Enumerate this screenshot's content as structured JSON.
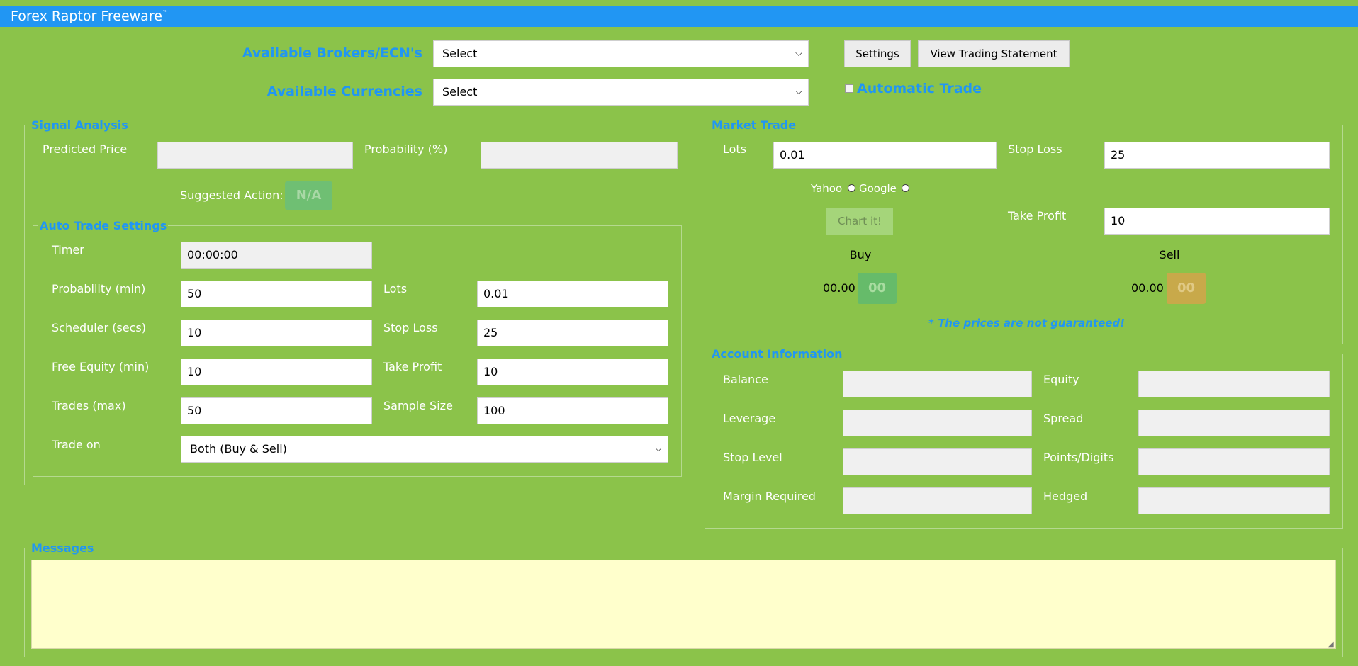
{
  "app": {
    "title": "Forex Raptor Freeware",
    "trademark": "™"
  },
  "header": {
    "brokers_label": "Available Brokers/ECN's",
    "brokers_value": "Select",
    "currencies_label": "Available Currencies",
    "currencies_value": "Select",
    "settings_button": "Settings",
    "statement_button": "View Trading Statement",
    "auto_trade_label": "Automatic Trade"
  },
  "signal_analysis": {
    "legend": "Signal Analysis",
    "predicted_price_label": "Predicted Price",
    "predicted_price_value": "",
    "probability_label": "Probability (%)",
    "probability_value": "",
    "suggested_action_label": "Suggested Action:",
    "suggested_action_value": "N/A"
  },
  "auto_trade": {
    "legend": "Auto Trade Settings",
    "timer_label": "Timer",
    "timer_value": "00:00:00",
    "prob_min_label": "Probability (min)",
    "prob_min_value": "50",
    "lots_label": "Lots",
    "lots_value": "0.01",
    "scheduler_label": "Scheduler (secs)",
    "scheduler_value": "10",
    "stop_loss_label": "Stop Loss",
    "stop_loss_value": "25",
    "free_equity_label": "Free Equity (min)",
    "free_equity_value": "10",
    "take_profit_label": "Take Profit",
    "take_profit_value": "10",
    "trades_max_label": "Trades (max)",
    "trades_max_value": "50",
    "sample_size_label": "Sample Size",
    "sample_size_value": "100",
    "trade_on_label": "Trade on",
    "trade_on_value": "Both (Buy & Sell)"
  },
  "market_trade": {
    "legend": "Market Trade",
    "lots_label": "Lots",
    "lots_value": "0.01",
    "stop_loss_label": "Stop Loss",
    "stop_loss_value": "25",
    "yahoo_label": "Yahoo",
    "google_label": "Google",
    "chart_button": "Chart it!",
    "take_profit_label": "Take Profit",
    "take_profit_value": "10",
    "buy_label": "Buy",
    "buy_price": "00.00",
    "buy_button": "00",
    "sell_label": "Sell",
    "sell_price": "00.00",
    "sell_button": "00",
    "disclaimer": "* The prices are not guaranteed!"
  },
  "account": {
    "legend": "Account Information",
    "balance_label": "Balance",
    "equity_label": "Equity",
    "leverage_label": "Leverage",
    "spread_label": "Spread",
    "stop_level_label": "Stop Level",
    "points_digits_label": "Points/Digits",
    "margin_required_label": "Margin Required",
    "hedged_label": "Hedged"
  },
  "messages": {
    "legend": "Messages",
    "content": ""
  },
  "colors": {
    "background": "#8bc34a",
    "titlebar": "#2196f3",
    "accent_blue": "#2196f3",
    "na_pill": "#6fbf73",
    "buy_pill": "#66bb6a",
    "sell_pill": "#c8a94a",
    "messages_bg": "#ffffcc"
  }
}
